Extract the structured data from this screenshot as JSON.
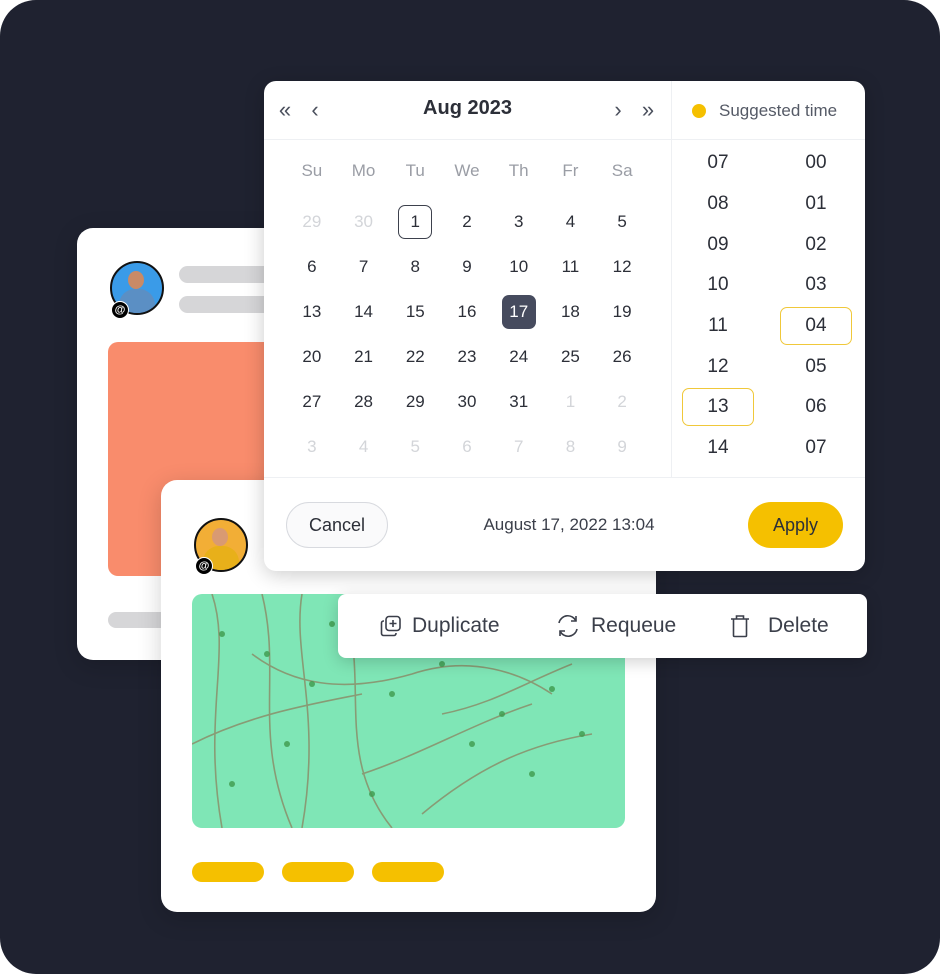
{
  "colors": {
    "background": "#1f2230",
    "accent": "#f5c000",
    "selected_day": "#464b5e",
    "time_highlight": "#f0c83a",
    "orange_image": "#f98c6c",
    "green_image": "#7fe6b6"
  },
  "post_back": {
    "avatar": "man-avatar",
    "badge": "@"
  },
  "post_front": {
    "avatar": "woman-avatar",
    "badge": "@"
  },
  "datepicker": {
    "month_title": "Aug 2023",
    "nav": {
      "prev_year": "«",
      "prev_month": "‹",
      "next_month": "›",
      "next_year": "»"
    },
    "weekdays": [
      "Su",
      "Mo",
      "Tu",
      "We",
      "Th",
      "Fr",
      "Sa"
    ],
    "days": [
      {
        "d": "29",
        "muted": true
      },
      {
        "d": "30",
        "muted": true
      },
      {
        "d": "1",
        "today": true
      },
      {
        "d": "2"
      },
      {
        "d": "3"
      },
      {
        "d": "4"
      },
      {
        "d": "5"
      },
      {
        "d": "6"
      },
      {
        "d": "7"
      },
      {
        "d": "8"
      },
      {
        "d": "9"
      },
      {
        "d": "10"
      },
      {
        "d": "11"
      },
      {
        "d": "12"
      },
      {
        "d": "13"
      },
      {
        "d": "14"
      },
      {
        "d": "15"
      },
      {
        "d": "16"
      },
      {
        "d": "17",
        "selected": true
      },
      {
        "d": "18"
      },
      {
        "d": "19"
      },
      {
        "d": "20"
      },
      {
        "d": "21"
      },
      {
        "d": "22"
      },
      {
        "d": "23"
      },
      {
        "d": "24"
      },
      {
        "d": "25"
      },
      {
        "d": "26"
      },
      {
        "d": "27"
      },
      {
        "d": "28"
      },
      {
        "d": "29"
      },
      {
        "d": "30"
      },
      {
        "d": "31"
      },
      {
        "d": "1",
        "muted": true
      },
      {
        "d": "2",
        "muted": true
      },
      {
        "d": "3",
        "muted": true
      },
      {
        "d": "4",
        "muted": true
      },
      {
        "d": "5",
        "muted": true
      },
      {
        "d": "6",
        "muted": true
      },
      {
        "d": "7",
        "muted": true
      },
      {
        "d": "8",
        "muted": true
      },
      {
        "d": "9",
        "muted": true
      }
    ],
    "suggested_label": "Suggested time",
    "hours": [
      "07",
      "08",
      "09",
      "10",
      "11",
      "12",
      "13",
      "14"
    ],
    "selected_hour": "13",
    "minutes": [
      "00",
      "01",
      "02",
      "03",
      "04",
      "05",
      "06",
      "07"
    ],
    "selected_minute": "04",
    "cancel_label": "Cancel",
    "apply_label": "Apply",
    "selected_datetime": "August 17, 2022 13:04"
  },
  "actions": {
    "duplicate": "Duplicate",
    "requeue": "Requeue",
    "delete": "Delete"
  }
}
